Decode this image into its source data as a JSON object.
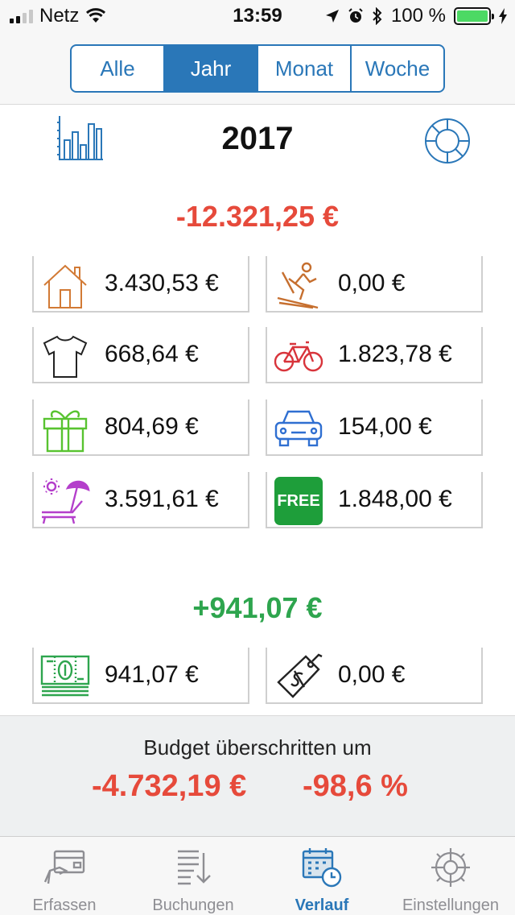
{
  "status": {
    "carrier": "Netz",
    "time": "13:59",
    "battery": "100 %"
  },
  "segments": [
    {
      "label": "Alle",
      "active": false
    },
    {
      "label": "Jahr",
      "active": true
    },
    {
      "label": "Monat",
      "active": false
    },
    {
      "label": "Woche",
      "active": false
    }
  ],
  "year": "2017",
  "expenses_total": "-12.321,25 €",
  "expense_categories": [
    {
      "icon": "house-icon",
      "amount": "3.430,53 €"
    },
    {
      "icon": "skier-icon",
      "amount": "0,00 €"
    },
    {
      "icon": "tshirt-icon",
      "amount": "668,64 €"
    },
    {
      "icon": "bicycle-icon",
      "amount": "1.823,78 €"
    },
    {
      "icon": "gift-icon",
      "amount": "804,69 €"
    },
    {
      "icon": "car-icon",
      "amount": "154,00 €"
    },
    {
      "icon": "beach-chair-icon",
      "amount": "3.591,61 €"
    },
    {
      "icon": "free-icon",
      "amount": "1.848,00 €",
      "icon_text": "FREE"
    }
  ],
  "income_total": "+941,07 €",
  "income_categories": [
    {
      "icon": "money-icon",
      "amount": "941,07 €"
    },
    {
      "icon": "price-tag-icon",
      "amount": "0,00 €"
    }
  ],
  "budget": {
    "label": "Budget überschritten um",
    "amount": "-4.732,19 €",
    "percent": "-98,6 %"
  },
  "tabs": [
    {
      "label": "Erfassen",
      "icon": "card-hand-icon",
      "active": false
    },
    {
      "label": "Buchungen",
      "icon": "list-icon",
      "active": false
    },
    {
      "label": "Verlauf",
      "icon": "calendar-clock-icon",
      "active": true
    },
    {
      "label": "Einstellungen",
      "icon": "gear-icon",
      "active": false
    }
  ],
  "colors": {
    "accent": "#2a77b8",
    "negative": "#e64a3b",
    "positive": "#2ea54e",
    "battery": "#4cd964"
  }
}
